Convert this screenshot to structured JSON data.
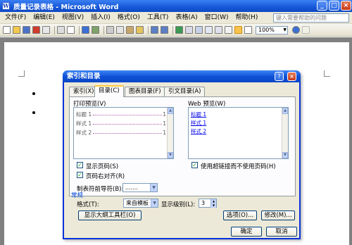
{
  "window": {
    "title": "质量记录表格 - Microsoft Word",
    "icon_letter": "W"
  },
  "menu": [
    "文件(F)",
    "编辑(E)",
    "视图(V)",
    "插入(I)",
    "格式(O)",
    "工具(T)",
    "表格(A)",
    "窗口(W)",
    "帮助(H)"
  ],
  "help_box": {
    "placeholder": "键入需要帮助的问题"
  },
  "toolbar": {
    "zoom": "100%"
  },
  "dialog": {
    "title": "索引和目录",
    "help_button": "?",
    "close_button": "×",
    "tabs": [
      "索引(X)",
      "目录(C)",
      "图表目录(F)",
      "引文目录(A)"
    ],
    "active_tab": 1,
    "print_preview": {
      "label": "打印预览(V)",
      "lines": [
        {
          "text": "标题 1",
          "page": "1"
        },
        {
          "text": "样式 1",
          "page": "1"
        },
        {
          "text": "样式 2",
          "page": "1"
        }
      ]
    },
    "web_preview": {
      "label": "Web 预览(W)",
      "links": [
        "标题 1",
        "样式 1",
        "样式 2"
      ]
    },
    "show_page_numbers": {
      "label": "显示页码(S)",
      "checked": true
    },
    "right_align": {
      "label": "页码右对齐(R)",
      "checked": true
    },
    "tab_leader": {
      "label": "制表符前导符(B):",
      "value": "......."
    },
    "use_hyperlinks": {
      "label": "使用超链接而不使用页码(H)",
      "checked": true
    },
    "general": {
      "label": "常规",
      "formats_label": "格式(T):",
      "formats_value": "来自模板",
      "levels_label": "显示级别(L):",
      "levels_value": "3"
    },
    "buttons": {
      "outline": "显示大纲工具栏(O)",
      "options": "选项(O)...",
      "modify": "修改(M)...",
      "ok": "确定",
      "cancel": "取消"
    }
  }
}
